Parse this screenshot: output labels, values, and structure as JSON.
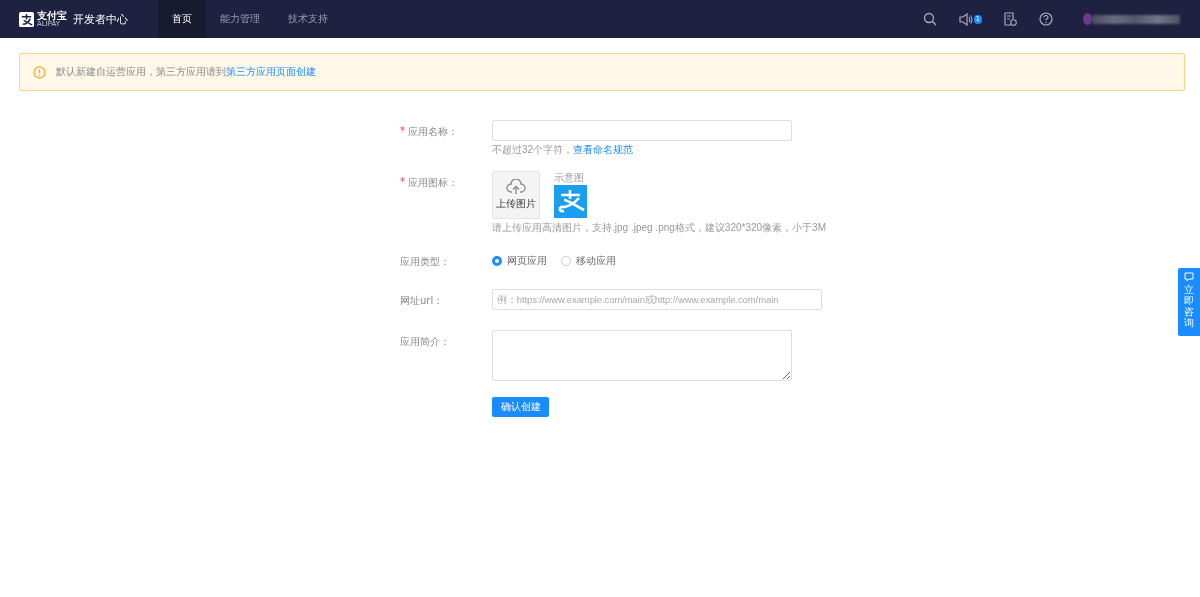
{
  "header": {
    "logo": {
      "name": "支付宝",
      "sub": "ALIPAY"
    },
    "title": "开发者中心",
    "nav": [
      {
        "label": "首页",
        "selected": true
      },
      {
        "label": "能力管理",
        "selected": false
      },
      {
        "label": "技术支持",
        "selected": false
      }
    ],
    "notification_count": "1"
  },
  "alert": {
    "text": "默认新建自运营应用，第三方应用请到",
    "link": "第三方应用页面创建"
  },
  "form": {
    "name": {
      "label": "应用名称：",
      "required_mark": "*",
      "hint": "不超过32个字符，",
      "hint_link": "查看命名规范"
    },
    "icon": {
      "label": "应用图标：",
      "required_mark": "*",
      "upload": "上传图片",
      "sample_label": "示意图",
      "hint": "请上传应用高清图片，支持.jpg .jpeg .png格式，建议320*320像素，小于3M"
    },
    "type": {
      "label": "应用类型：",
      "options": [
        {
          "label": "网页应用",
          "selected": true
        },
        {
          "label": "移动应用",
          "selected": false
        }
      ]
    },
    "url": {
      "label": "网址url：",
      "placeholder": "例：https://www.example.com/main或http://www.example.com/main"
    },
    "intro": {
      "label": "应用简介："
    },
    "submit": "确认创建"
  },
  "consult": "立即咨询"
}
